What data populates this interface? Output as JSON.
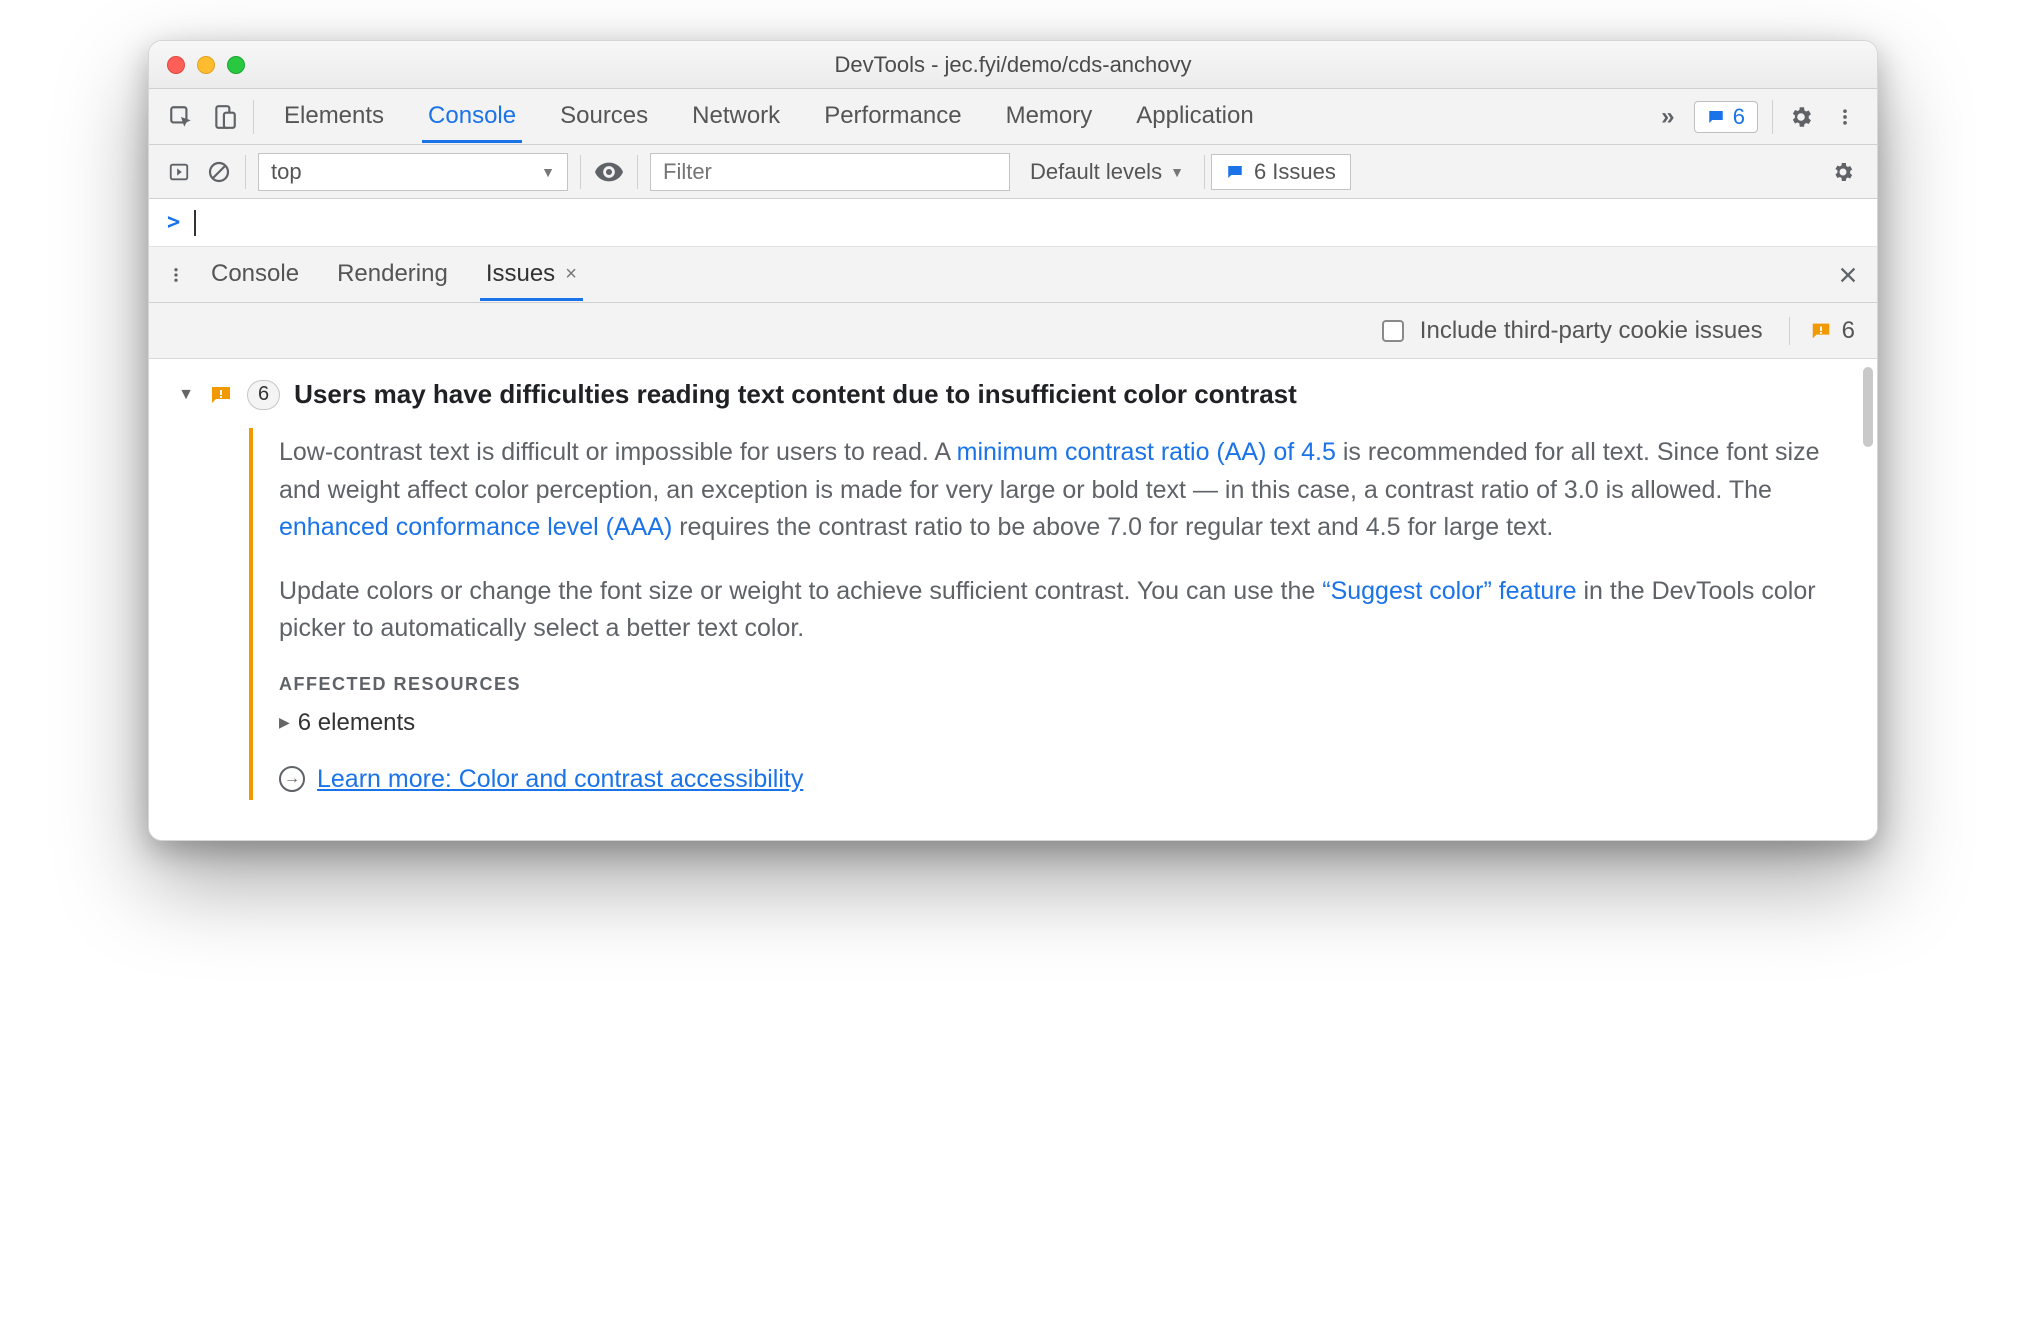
{
  "window": {
    "title": "DevTools - jec.fyi/demo/cds-anchovy"
  },
  "mainTabs": {
    "items": [
      "Elements",
      "Console",
      "Sources",
      "Network",
      "Performance",
      "Memory",
      "Application"
    ],
    "activeIndex": 1,
    "moreGlyph": "»",
    "badgeCount": "6"
  },
  "consoleBar": {
    "context": "top",
    "filterPlaceholder": "Filter",
    "levelsLabel": "Default levels",
    "issuesLabel": "6 Issues"
  },
  "prompt": {
    "glyph": ">"
  },
  "drawerTabs": {
    "items": [
      "Console",
      "Rendering",
      "Issues"
    ],
    "activeIndex": 2,
    "closeGlyph": "×"
  },
  "issuesBar": {
    "checkboxLabel": "Include third-party cookie issues",
    "totalCount": "6"
  },
  "issue": {
    "count": "6",
    "title": "Users may have difficulties reading text content due to insufficient color contrast",
    "p1_a": "Low-contrast text is difficult or impossible for users to read. A ",
    "link1": "minimum contrast ratio (AA) of 4.5",
    "p1_b": " is recommended for all text. Since font size and weight affect color perception, an exception is made for very large or bold text — in this case, a contrast ratio of 3.0 is allowed. The ",
    "link2": "enhanced conformance level (AAA)",
    "p1_c": " requires the contrast ratio to be above 7.0 for regular text and 4.5 for large text.",
    "p2_a": "Update colors or change the font size or weight to achieve sufficient contrast. You can use the ",
    "link3": "“Suggest color” feature",
    "p2_b": " in the DevTools color picker to automatically select a better text color.",
    "affectedHeader": "AFFECTED RESOURCES",
    "affectedItem": "6 elements",
    "learnMore": "Learn more: Color and contrast accessibility"
  }
}
